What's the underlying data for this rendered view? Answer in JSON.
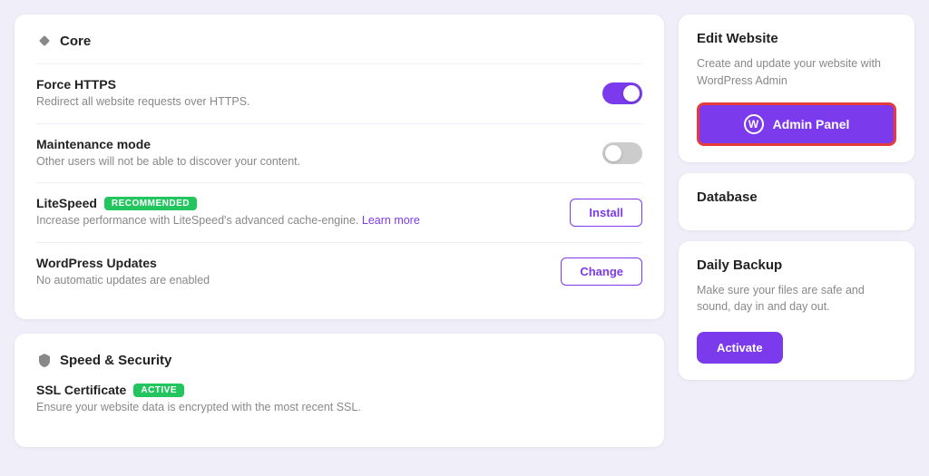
{
  "left": {
    "core_card": {
      "title": "Core",
      "force_https": {
        "label": "Force HTTPS",
        "description": "Redirect all website requests over HTTPS.",
        "toggle_state": "on"
      },
      "maintenance_mode": {
        "label": "Maintenance mode",
        "description": "Other users will not be able to discover your content.",
        "toggle_state": "off"
      },
      "litespeed": {
        "label": "LiteSpeed",
        "badge": "RECOMMENDED",
        "description": "Increase performance with LiteSpeed's advanced cache-engine.",
        "learn_more": "Learn more",
        "button_label": "Install"
      },
      "wordpress_updates": {
        "label": "WordPress Updates",
        "description": "No automatic updates are enabled",
        "button_label": "Change"
      }
    },
    "speed_security_card": {
      "title": "Speed & Security",
      "ssl_certificate": {
        "label": "SSL Certificate",
        "badge": "ACTIVE",
        "description": "Ensure your website data is encrypted with the most recent SSL."
      }
    }
  },
  "right": {
    "edit_website": {
      "title": "Edit Website",
      "description": "Create and update your website with WordPress Admin",
      "admin_panel_label": "Admin Panel"
    },
    "database": {
      "title": "Database"
    },
    "daily_backup": {
      "title": "Daily Backup",
      "description": "Make sure your files are safe and sound, day in and day out.",
      "activate_label": "Activate"
    }
  }
}
